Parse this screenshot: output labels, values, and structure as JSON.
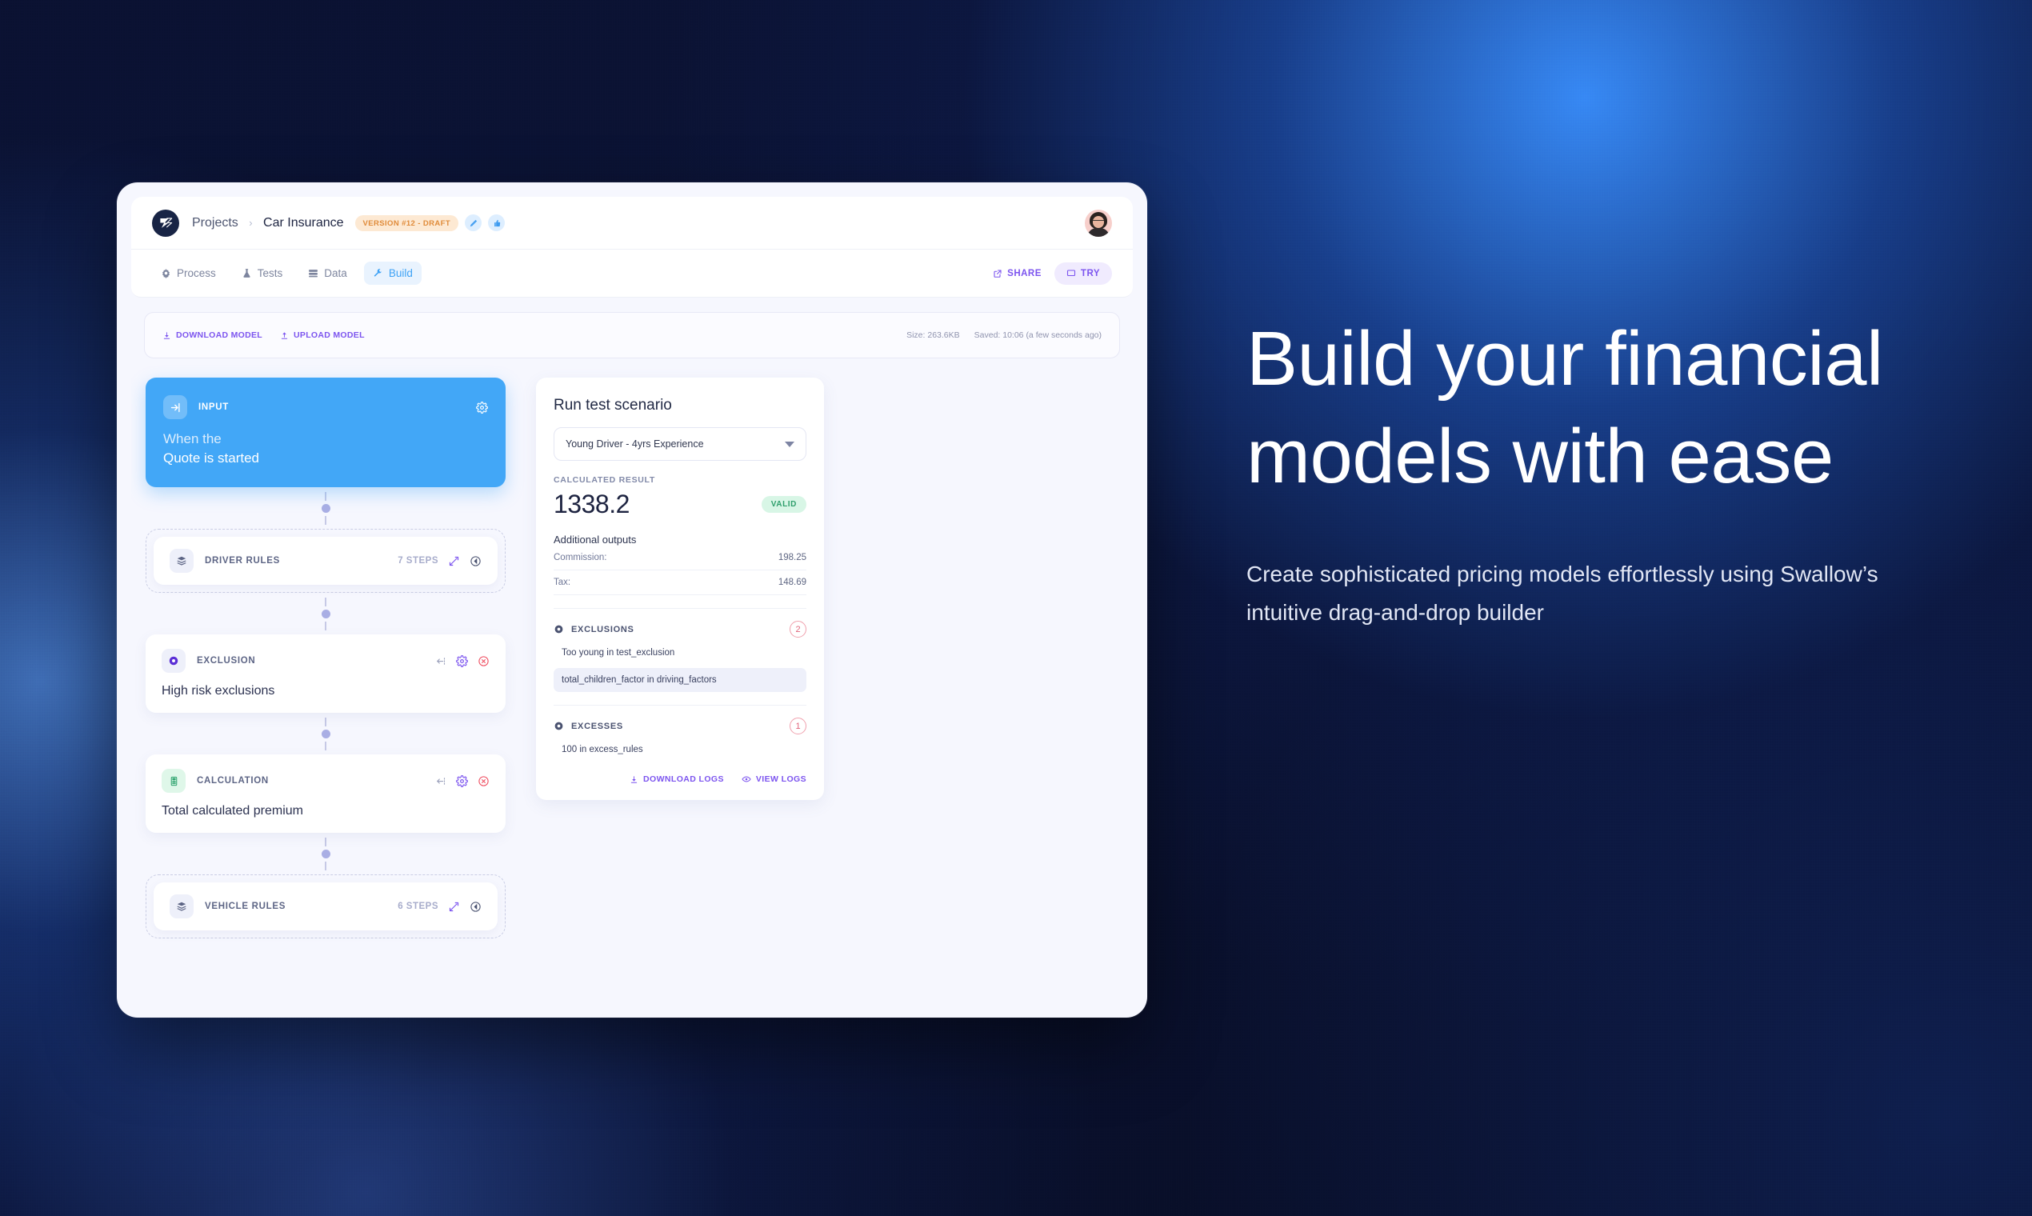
{
  "window": {
    "topbar": {
      "logo_icon": "swallow-logo-icon",
      "breadcrumb": {
        "root": "Projects",
        "separator": "›",
        "current": "Car Insurance"
      },
      "version_badge": "VERSION #12 - DRAFT",
      "edit_icon": "pencil-icon",
      "approve_icon": "thumbs-up-icon",
      "avatar": "user-avatar"
    },
    "tabs": [
      {
        "label": "Process",
        "icon": "gear-icon",
        "active": false
      },
      {
        "label": "Tests",
        "icon": "flask-icon",
        "active": false
      },
      {
        "label": "Data",
        "icon": "database-icon",
        "active": false
      },
      {
        "label": "Build",
        "icon": "wrench-icon",
        "active": true
      }
    ],
    "tab_actions": {
      "share_label": "SHARE",
      "share_icon": "external-link-icon",
      "try_label": "TRY",
      "try_icon": "monitor-icon"
    },
    "filebar": {
      "download_label": "DOWNLOAD MODEL",
      "download_icon": "download-icon",
      "upload_label": "UPLOAD MODEL",
      "upload_icon": "upload-icon",
      "size": "Size: 263.6KB",
      "saved": "Saved: 10:06 (a few seconds ago)"
    }
  },
  "flow": {
    "input_node": {
      "kind": "INPUT",
      "icon": "login-arrow-icon",
      "when_label": "When the",
      "title": "Quote is started",
      "settings_icon": "gear-icon"
    },
    "driver_rules": {
      "kind": "DRIVER RULES",
      "icon": "stack-icon",
      "steps": "7 STEPS",
      "edit_icon": "edit-square-icon",
      "collapse_icon": "collapse-left-icon"
    },
    "exclusion": {
      "kind": "EXCLUSION",
      "icon": "exclusion-dot-icon",
      "title": "High risk exclusions",
      "move_icon": "arrow-left-dotted-icon",
      "settings_icon": "gear-icon",
      "remove_icon": "remove-circle-icon"
    },
    "calculation": {
      "kind": "CALCULATION",
      "icon": "calculator-icon",
      "title": "Total calculated premium",
      "move_icon": "arrow-left-dotted-icon",
      "settings_icon": "gear-icon",
      "remove_icon": "remove-circle-icon"
    },
    "vehicle_rules": {
      "kind": "VEHICLE RULES",
      "icon": "stack-icon",
      "steps": "6 STEPS",
      "edit_icon": "edit-square-icon",
      "collapse_icon": "collapse-left-icon"
    }
  },
  "panel": {
    "title": "Run test scenario",
    "scenario_value": "Young Driver - 4yrs Experience",
    "result_label": "CALCULATED RESULT",
    "result_value": "1338.2",
    "status_badge": "VALID",
    "additional_outputs_title": "Additional outputs",
    "outputs": [
      {
        "key": "Commission:",
        "value": "198.25"
      },
      {
        "key": "Tax:",
        "value": "148.69"
      }
    ],
    "exclusions": {
      "title": "EXCLUSIONS",
      "icon": "exclusion-dot-icon",
      "count": "2",
      "items": [
        "Too young in test_exclusion",
        "total_children_factor in driving_factors"
      ]
    },
    "excesses": {
      "title": "EXCESSES",
      "icon": "exclusion-dot-icon",
      "count": "1",
      "items": [
        "100 in excess_rules"
      ]
    },
    "footer": {
      "download_logs": "DOWNLOAD LOGS",
      "download_icon": "download-icon",
      "view_logs": "VIEW LOGS",
      "view_icon": "eye-icon"
    }
  },
  "marketing": {
    "headline": "Build your financial models with ease",
    "subtext": "Create sophisticated pricing models effortlessly using Swallow’s intuitive drag-and-drop builder"
  },
  "colors": {
    "accent_blue": "#42a7f7",
    "accent_purple": "#7c54ef",
    "valid_green": "#2f9f6c",
    "badge_orange": "#e08b3a",
    "danger_red": "#e0657c",
    "window_bg": "#f6f7fe"
  }
}
